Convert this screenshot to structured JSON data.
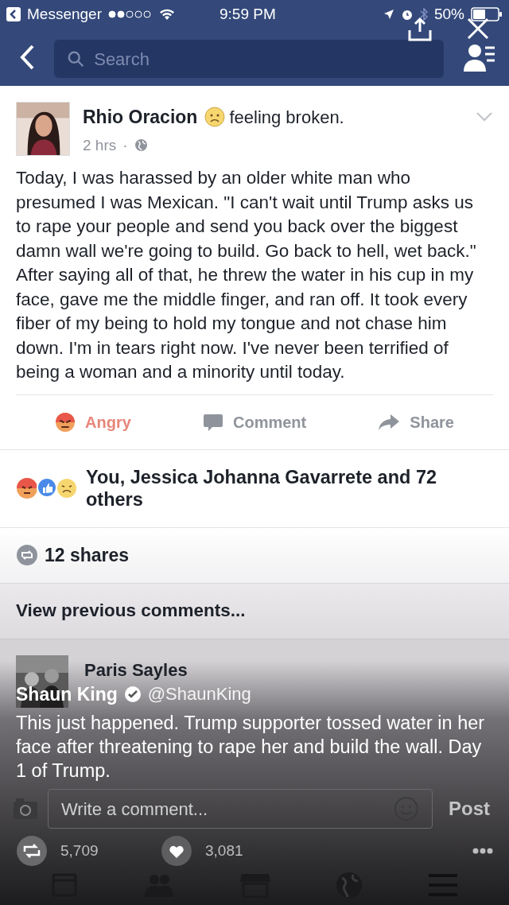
{
  "status_bar": {
    "back_app": "Messenger",
    "time": "9:59 PM",
    "battery": "50%"
  },
  "search": {
    "placeholder": "Search"
  },
  "post": {
    "author": "Rhio Oracion",
    "feeling": "feeling broken.",
    "time": "2 hrs",
    "separator": "·",
    "body": "Today, I was harassed by an older white man who presumed I was Mexican. \"I can't wait until Trump asks us to rape your people and send you back over the biggest damn wall we're going to build. Go back to hell, wet back.\" After saying all of that, he threw the water in his cup in my face, gave me the middle finger, and ran off. It took every fiber of my being to hold my tongue and not chase him down. I'm in tears right now. I've never been terrified of being a woman and a minority until today.",
    "actions": [
      {
        "kind": "angry",
        "label": "Angry",
        "selected": true
      },
      {
        "kind": "comment",
        "label": "Comment",
        "selected": false
      },
      {
        "kind": "share",
        "label": "Share",
        "selected": false
      }
    ],
    "reactions": "You, Jessica Johanna Gavarrete and 72 others",
    "shares": "12 shares",
    "view_previous": "View previous comments...",
    "comment_author": "Paris Sayles",
    "comment_box": {
      "placeholder": "Write a comment..."
    },
    "post_button": "Post"
  },
  "tweet": {
    "author": "Shaun King",
    "verified": true,
    "handle": "@ShaunKing",
    "text": "This just happened. Trump supporter tossed water in her face after threatening to rape her and build the wall. Day 1 of Trump.",
    "retweets": "5,709",
    "likes": "3,081"
  }
}
